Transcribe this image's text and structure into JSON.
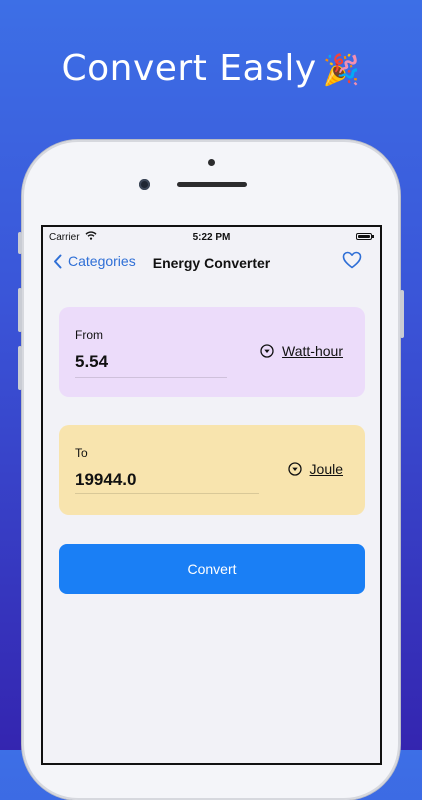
{
  "headline": {
    "text": "Convert Easly",
    "emoji": "🎉"
  },
  "status_bar": {
    "carrier": "Carrier",
    "time": "5:22 PM"
  },
  "nav": {
    "back_label": "Categories",
    "title": "Energy Converter"
  },
  "from_card": {
    "label": "From",
    "value": "5.54",
    "unit": "Watt-hour"
  },
  "to_card": {
    "label": "To",
    "value": "19944.0",
    "unit": "Joule"
  },
  "convert_button": {
    "label": "Convert"
  },
  "colors": {
    "accent": "#2f6fd6",
    "button": "#1a7ff5",
    "from_card_bg": "#ecdcfa",
    "to_card_bg": "#f8e4ae",
    "screen_bg": "#f2f2f7"
  },
  "icons": [
    "chevron-left-icon",
    "heart-icon",
    "wifi-icon",
    "battery-icon",
    "dropdown-circle-icon"
  ]
}
